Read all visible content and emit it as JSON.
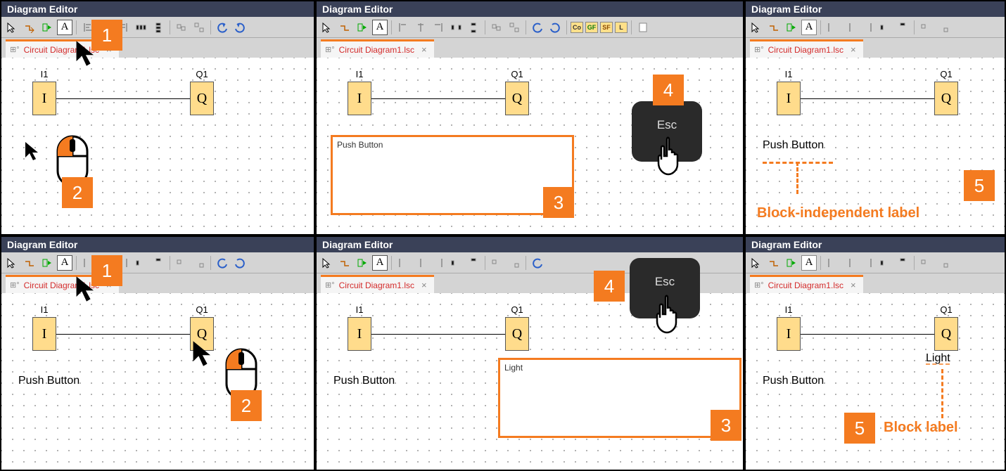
{
  "app_title": "Diagram Editor",
  "tab_name": "Circuit Diagram1.lsc",
  "blocks": {
    "i_label": "I1",
    "i_text": "I",
    "q_label": "Q1",
    "q_text": "Q"
  },
  "labels": {
    "push_button": "Push Button",
    "light": "Light"
  },
  "textbox": {
    "push_button": "Push Button",
    "light": "Light"
  },
  "callouts": {
    "n1": "1",
    "n2": "2",
    "n3": "3",
    "n4": "4",
    "n5": "5",
    "block_independent": "Block-independent label",
    "block_label": "Block label"
  },
  "key": {
    "esc": "Esc"
  },
  "tool_a": "A",
  "colorboxes": {
    "co": "Co",
    "gf": "GF",
    "sf": "SF",
    "l": "L"
  }
}
